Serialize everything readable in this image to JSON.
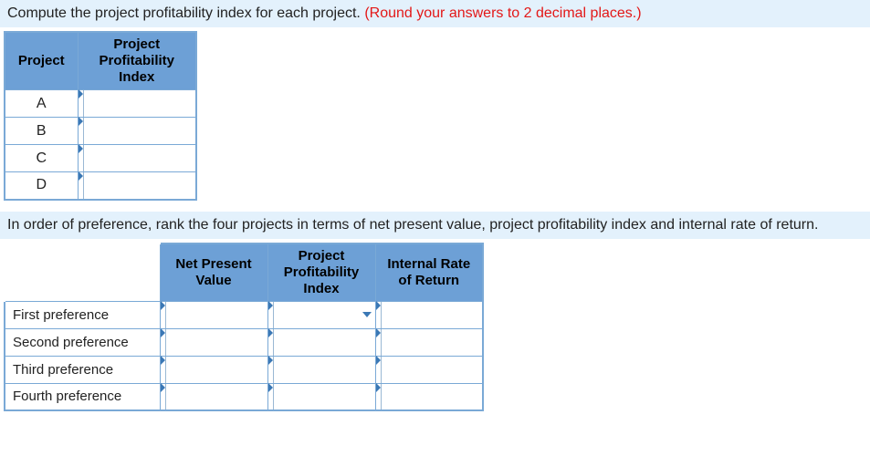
{
  "prompt1_a": "Compute the project profitability index for each project.",
  "prompt1_b": "(Round your answers to 2 decimal places.)",
  "t1": {
    "headers": [
      "Project",
      "Project Profitability Index"
    ],
    "rows": [
      "A",
      "B",
      "C",
      "D"
    ]
  },
  "prompt2": "In order of preference, rank the four projects in terms of net present value, project profitability index and internal rate of return.",
  "t2": {
    "headers": [
      "Net Present Value",
      "Project Profitability Index",
      "Internal Rate of Return"
    ],
    "rows": [
      "First preference",
      "Second preference",
      "Third preference",
      "Fourth preference"
    ]
  }
}
